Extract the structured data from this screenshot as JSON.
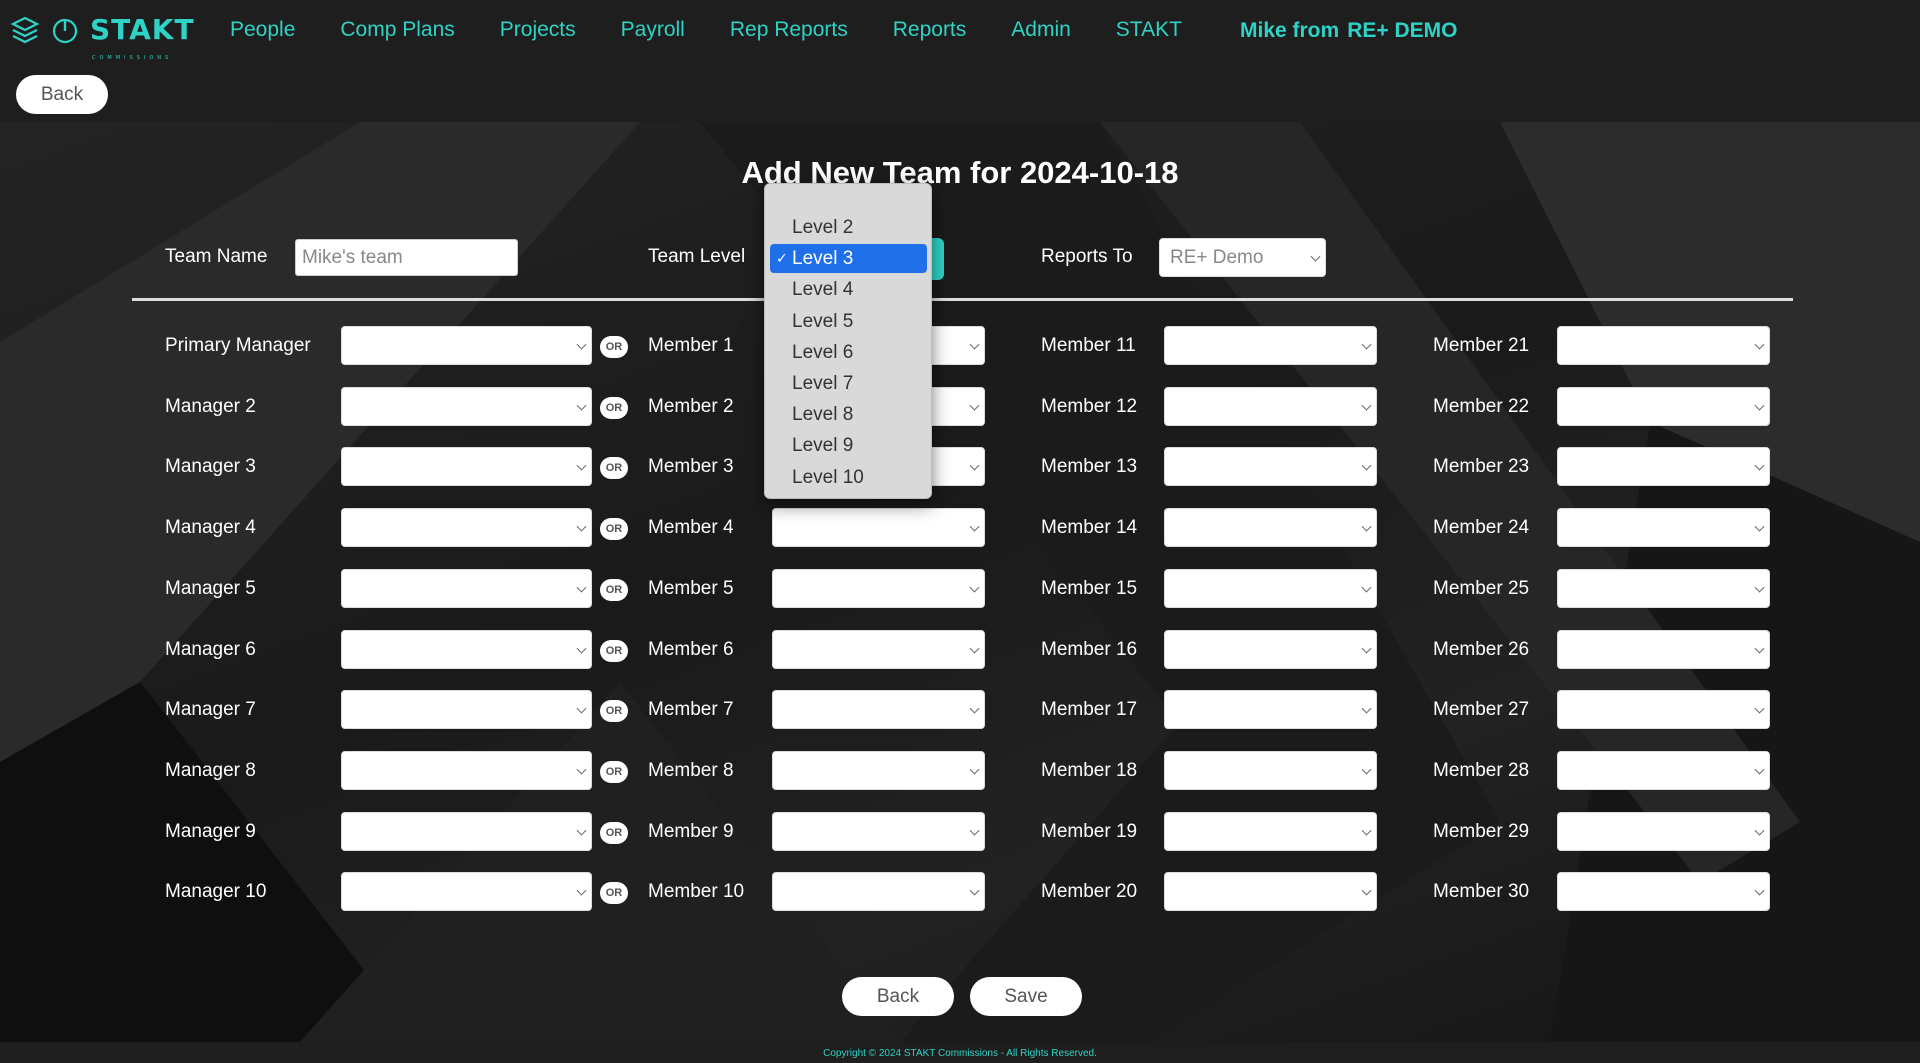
{
  "brand": {
    "name": "STAKT",
    "tagline": "COMMISSIONS",
    "accent": "#2ed3c6"
  },
  "nav": {
    "links": [
      "People",
      "Comp Plans",
      "Projects",
      "Payroll",
      "Rep Reports",
      "Reports",
      "Admin",
      "STAKT"
    ],
    "user": "Mike from",
    "company": "RE+ DEMO"
  },
  "back_label": "Back",
  "title": "Add New Team for 2024-10-18",
  "form": {
    "team_name_label": "Team Name",
    "team_name_value": "Mike's team",
    "team_level_label": "Team Level",
    "reports_to_label": "Reports To",
    "reports_to_value": "RE+ Demo"
  },
  "dropdown": {
    "options": [
      "Level 2",
      "Level 3",
      "Level 4",
      "Level 5",
      "Level 6",
      "Level 7",
      "Level 8",
      "Level 9",
      "Level 10"
    ],
    "selected": "Level 3",
    "selected_color": "#1f6fe8"
  },
  "managers": [
    "Primary Manager",
    "Manager 2",
    "Manager 3",
    "Manager 4",
    "Manager 5",
    "Manager 6",
    "Manager 7",
    "Manager 8",
    "Manager 9",
    "Manager 10"
  ],
  "or_label": "OR",
  "members_col1": [
    "Member 1",
    "Member 2",
    "Member 3",
    "Member 4",
    "Member 5",
    "Member 6",
    "Member 7",
    "Member 8",
    "Member 9",
    "Member 10"
  ],
  "members_col2": [
    "Member 11",
    "Member 12",
    "Member 13",
    "Member 14",
    "Member 15",
    "Member 16",
    "Member 17",
    "Member 18",
    "Member 19",
    "Member 20"
  ],
  "members_col3": [
    "Member 21",
    "Member 22",
    "Member 23",
    "Member 24",
    "Member 25",
    "Member 26",
    "Member 27",
    "Member 28",
    "Member 29",
    "Member 30"
  ],
  "buttons": {
    "back": "Back",
    "save": "Save"
  },
  "footer": "Copyright © 2024 STAKT Commissions - All Rights Reserved."
}
